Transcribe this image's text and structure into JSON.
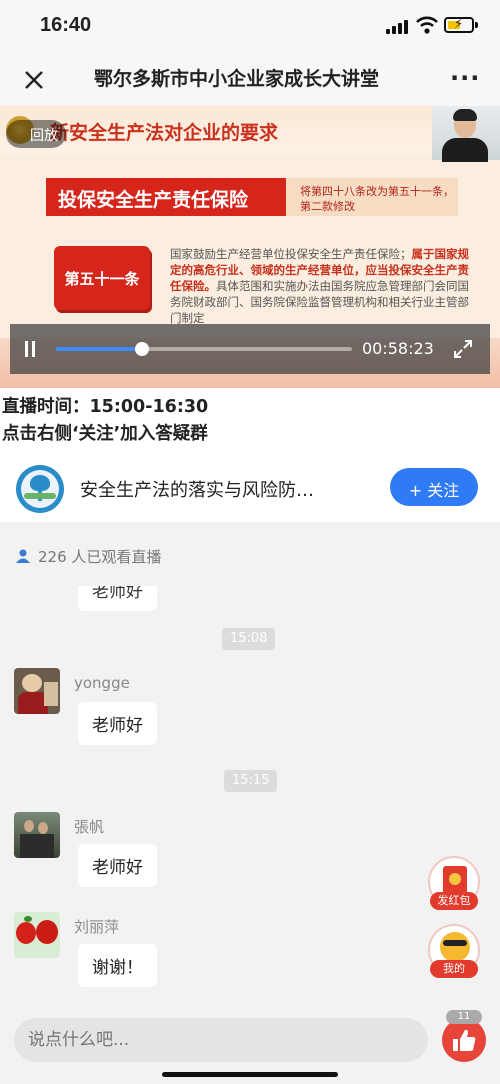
{
  "status_bar": {
    "time": "16:40"
  },
  "header": {
    "title": "鄂尔多斯市中小企业家成长大讲堂"
  },
  "video": {
    "slide_title": "新安全生产法对企业的要求",
    "replay_label": "回放",
    "banner_title": "投保安全生产责任保险",
    "banner_note": "将第四十八条改为第五十一条，第二款修改",
    "article_label": "第五十一条",
    "article_text_1": "国家鼓励生产经营单位投保安全生产责任保险；",
    "article_text_hl": "属于国家规定的高危行业、领域的生产经营单位，应当投保安全生产责任保险。",
    "article_text_2": "具体范围和实施办法由国务院应急管理部门会同国务院财政部门、国务院保险监督管理机构和相关行业主管部门制定",
    "elapsed": "00:58:23",
    "progress": 0.29
  },
  "description": {
    "line1": "直播时间：15:00-16:30",
    "line2": "点击右侧‘关注’加入答疑群"
  },
  "channel": {
    "name": "安全生产法的落实与风险防…",
    "follow_label": "+ 关注"
  },
  "viewers": {
    "text": "226 人已观看直播"
  },
  "chat": {
    "partial_message": "老师好",
    "time1": "15:08",
    "time2": "15:15",
    "messages": [
      {
        "sender": "yongge",
        "text": "老师好"
      },
      {
        "sender": "張帆",
        "text": "老师好"
      },
      {
        "sender": "刘丽萍",
        "text": "谢谢！"
      }
    ]
  },
  "fabs": {
    "red_packet": "发红包",
    "mine": "我的"
  },
  "input": {
    "placeholder": "说点什么吧..."
  },
  "like": {
    "count": "11"
  },
  "colors": {
    "accent_blue": "#2f7bf5",
    "slide_red": "#d6261c",
    "like_red": "#e7443a"
  }
}
